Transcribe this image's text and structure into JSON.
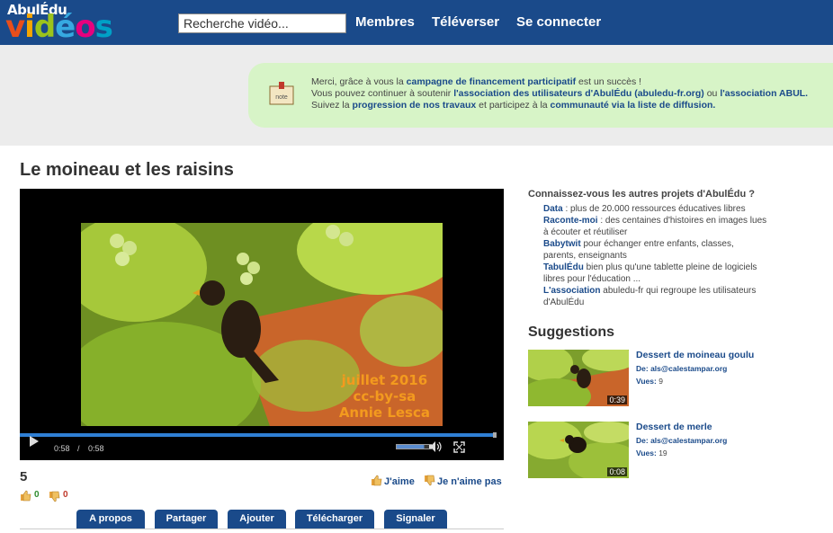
{
  "logo": {
    "top": "AbulÉdu",
    "bottom_letters": [
      "v",
      "i",
      "d",
      "é",
      "o",
      "s"
    ]
  },
  "search": {
    "placeholder": "Recherche vidéo..."
  },
  "nav": {
    "members": "Membres",
    "upload": "Téléverser",
    "login": "Se connecter"
  },
  "notice": {
    "icon_label": "note",
    "line1": {
      "pre": "Merci, grâce à vous la ",
      "link": "campagne de financement participatif",
      "post": " est un succès !"
    },
    "line2": {
      "pre": "Vous pouvez continuer à soutenir ",
      "link1": "l'association des utilisateurs d'AbulÉdu (abuledu-fr.org)",
      "mid": " ou ",
      "link2": "l'association ABUL."
    },
    "line3": {
      "pre": "Suivez la ",
      "link1": "progression de nos travaux",
      "mid": " et participez à la ",
      "link2": "communauté via la liste de diffusion."
    }
  },
  "video": {
    "title": "Le moineau et les raisins",
    "overlay": [
      "juillet 2016",
      "cc-by-sa",
      "Annie Lesca"
    ],
    "current_time": "0:58",
    "separator": "/",
    "duration": "0:58",
    "progress": 1.0,
    "volume": 0.8
  },
  "stats": {
    "views": "5",
    "likes": "0",
    "dislikes": "0",
    "like_label": "J'aime",
    "dislike_label": "Je n'aime pas"
  },
  "tabs": [
    "A propos",
    "Partager",
    "Ajouter",
    "Télécharger",
    "Signaler"
  ],
  "projects": {
    "title": "Connaissez-vous les autres projets d'AbulÉdu ?",
    "items": [
      {
        "name": "Data",
        "desc": " : plus de 20.000 ressources éducatives libres"
      },
      {
        "name": "Raconte-moi",
        "desc": " : des centaines d'histoires en images lues à écouter et réutiliser"
      },
      {
        "name": "Babytwit",
        "desc": " pour échanger entre enfants, classes, parents, enseignants"
      },
      {
        "name": "TabulÉdu",
        "desc": " bien plus qu'une tablette pleine de logiciels libres pour l'éducation ..."
      },
      {
        "name": "L'association",
        "desc": " abuledu-fr qui regroupe les utilisateurs d'AbulÉdu"
      }
    ]
  },
  "suggestions": {
    "title": "Suggestions",
    "items": [
      {
        "title": "Dessert de moineau goulu",
        "from_label": "De: ",
        "from": "als@calestampar.org",
        "views_label": "Vues: ",
        "views": "9",
        "duration": "0:39"
      },
      {
        "title": "Dessert de merle",
        "from_label": "De: ",
        "from": "als@calestampar.org",
        "views_label": "Vues: ",
        "views": "19",
        "duration": "0:08"
      }
    ]
  },
  "colors": {
    "header": "#1a4a8a",
    "notice_bg": "#d7f4c7",
    "link": "#1a4a8a",
    "overlay_text": "#f39a1e"
  }
}
